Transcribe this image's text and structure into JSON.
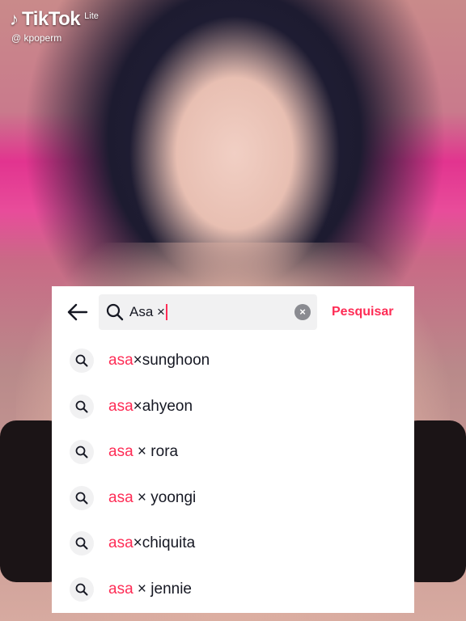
{
  "watermark": {
    "brand": "TikTok",
    "edition": "Lite",
    "username": "@ kpoperm"
  },
  "search": {
    "query": "Asa ×",
    "submit_label": "Pesquisar"
  },
  "suggestions": [
    {
      "highlight": "asa",
      "rest": "×sunghoon"
    },
    {
      "highlight": "asa",
      "rest": "×ahyeon"
    },
    {
      "highlight": "asa",
      "rest": " × rora"
    },
    {
      "highlight": "asa",
      "rest": " × yoongi"
    },
    {
      "highlight": "asa",
      "rest": "×chiquita"
    },
    {
      "highlight": "asa",
      "rest": " × jennie"
    }
  ],
  "colors": {
    "accent": "#fe2c55",
    "text": "#161823",
    "field_bg": "#f1f1f2"
  },
  "icons": {
    "back": "arrow-left-icon",
    "search": "search-icon",
    "clear": "clear-circle-icon",
    "suggestion": "search-icon"
  }
}
